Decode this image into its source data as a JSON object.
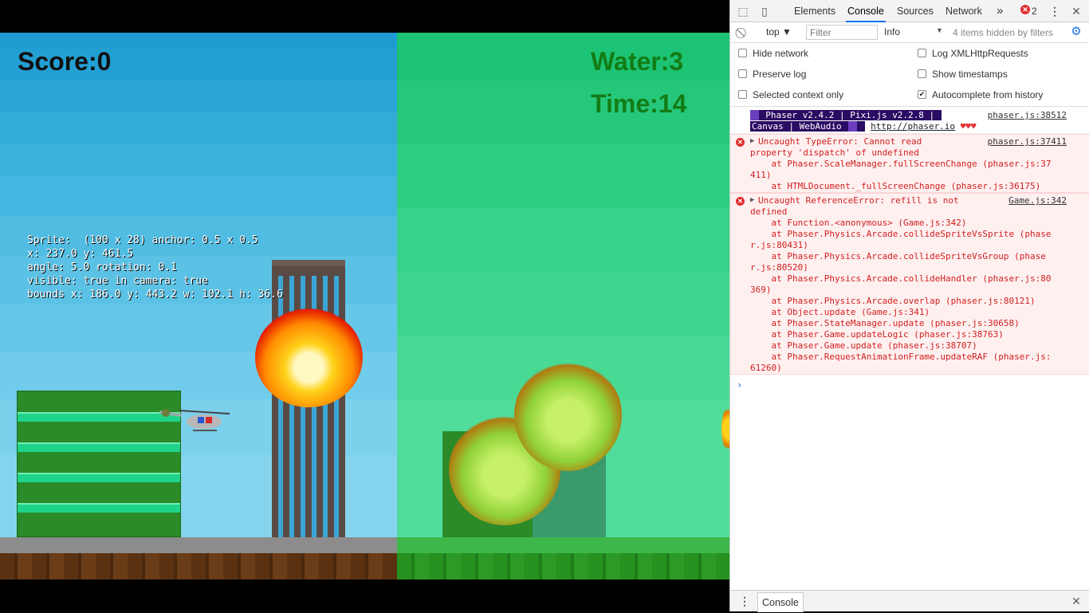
{
  "hud": {
    "score": "Score:0",
    "water": "Water:3",
    "time": "Time:14"
  },
  "debug": {
    "lines": [
      "Sprite:  (100 x 28) anchor: 0.5 x 0.5",
      "x: 237.0 y: 461.5",
      "angle: 5.0 rotation: 0.1",
      "visible: true in camera: true",
      "bounds x: 186.0 y: 443.2 w: 102.1 h: 36.6"
    ]
  },
  "devtools": {
    "tabs": [
      "Elements",
      "Console",
      "Sources",
      "Network"
    ],
    "more": "»",
    "error_count": "2",
    "context": "top",
    "filter_placeholder": "Filter",
    "level": "Info",
    "hidden_note": "4 items hidden by filters",
    "options": [
      {
        "label": "Hide network",
        "checked": false
      },
      {
        "label": "Log XMLHttpRequests",
        "checked": false
      },
      {
        "label": "Preserve log",
        "checked": false
      },
      {
        "label": "Show timestamps",
        "checked": false
      },
      {
        "label": "Selected context only",
        "checked": false
      },
      {
        "label": "Autocomplete from history",
        "checked": true
      }
    ],
    "messages": {
      "banner_1": " Phaser v2.4.2 | Pixi.js v2.2.8 | ",
      "banner_2": "Canvas | WebAudio ",
      "banner_link": "http://phaser.io",
      "banner_hearts": "♥♥♥",
      "banner_src": "phaser.js:38512",
      "err1_lines": [
        "Uncaught TypeError: Cannot read",
        "property 'dispatch' of undefined",
        "    at Phaser.ScaleManager.fullScreenChange (phaser.js:37",
        "411)",
        "    at HTMLDocument._fullScreenChange (phaser.js:36175)"
      ],
      "err1_src": "phaser.js:37411",
      "err2_lines": [
        "Uncaught ReferenceError: refill is not",
        "defined",
        "    at Function.<anonymous> (Game.js:342)",
        "    at Phaser.Physics.Arcade.collideSpriteVsSprite (phase",
        "r.js:80431)",
        "    at Phaser.Physics.Arcade.collideSpriteVsGroup (phase",
        "r.js:80520)",
        "    at Phaser.Physics.Arcade.collideHandler (phaser.js:80",
        "369)",
        "    at Phaser.Physics.Arcade.overlap (phaser.js:80121)",
        "    at Object.update (Game.js:341)",
        "    at Phaser.StateManager.update (phaser.js:30658)",
        "    at Phaser.Game.updateLogic (phaser.js:38763)",
        "    at Phaser.Game.update (phaser.js:38707)",
        "    at Phaser.RequestAnimationFrame.updateRAF (phaser.js:",
        "61260)"
      ],
      "err2_src": "Game.js:342"
    },
    "drawer_tab": "Console"
  }
}
